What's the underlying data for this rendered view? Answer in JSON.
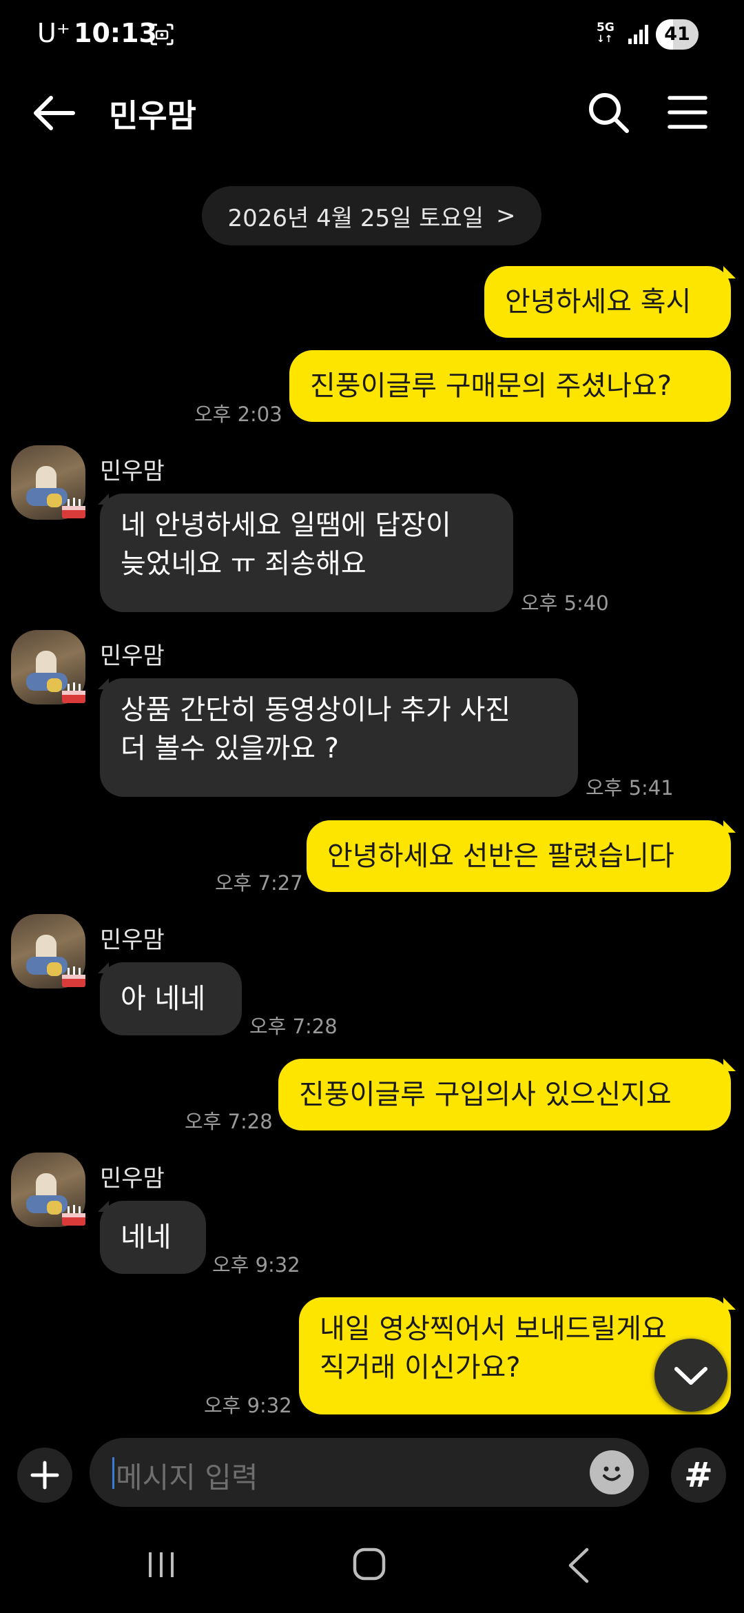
{
  "status_bar": {
    "carrier": "U⁺",
    "time": "10:13",
    "network": "5G",
    "battery_percent": 41
  },
  "header": {
    "title": "민우맘"
  },
  "date_separator": {
    "label": "2026년 4월 25일 토요일",
    "chevron": ">"
  },
  "messages": [
    {
      "from": "me",
      "text": "안녕하세요 혹시",
      "time": ""
    },
    {
      "from": "me",
      "text": "진풍이글루 구매문의 주셨나요?",
      "time": "오후 2:03"
    },
    {
      "from": "them",
      "sender": "민우맘",
      "lines": [
        "네 안녕하세요 일땜에 답장이",
        "늦었네요 ㅠ 죄송해요"
      ],
      "time": "오후 5:40"
    },
    {
      "from": "them",
      "sender": "민우맘",
      "lines": [
        "상품 간단히 동영상이나 추가 사진",
        "더 볼수 있을까요 ?"
      ],
      "time": "오후 5:41"
    },
    {
      "from": "me",
      "text": "안녕하세요 선반은 팔렸습니다",
      "time": "오후 7:27"
    },
    {
      "from": "them",
      "sender": "민우맘",
      "text": "아 네네",
      "time": "오후 7:28"
    },
    {
      "from": "me",
      "text": "진풍이글루 구입의사 있으신지요",
      "time": "오후 7:28"
    },
    {
      "from": "them",
      "sender": "민우맘",
      "text": "네네",
      "time": "오후 9:32"
    },
    {
      "from": "me",
      "lines": [
        "내일 영상찍어서 보내드릴게요",
        "직거래 이신가요?"
      ],
      "time": "오후 9:32"
    }
  ],
  "input": {
    "placeholder": "메시지 입력",
    "hash_label": "#"
  },
  "icons": {
    "back": "back-arrow-icon",
    "search": "search-icon",
    "menu": "hamburger-menu-icon",
    "plus": "plus-icon",
    "emoji": "emoji-icon",
    "scroll_down": "chevron-down-icon"
  },
  "colors": {
    "my_bubble": "#fee500",
    "their_bubble": "#2c2c2c",
    "background": "#000000"
  }
}
